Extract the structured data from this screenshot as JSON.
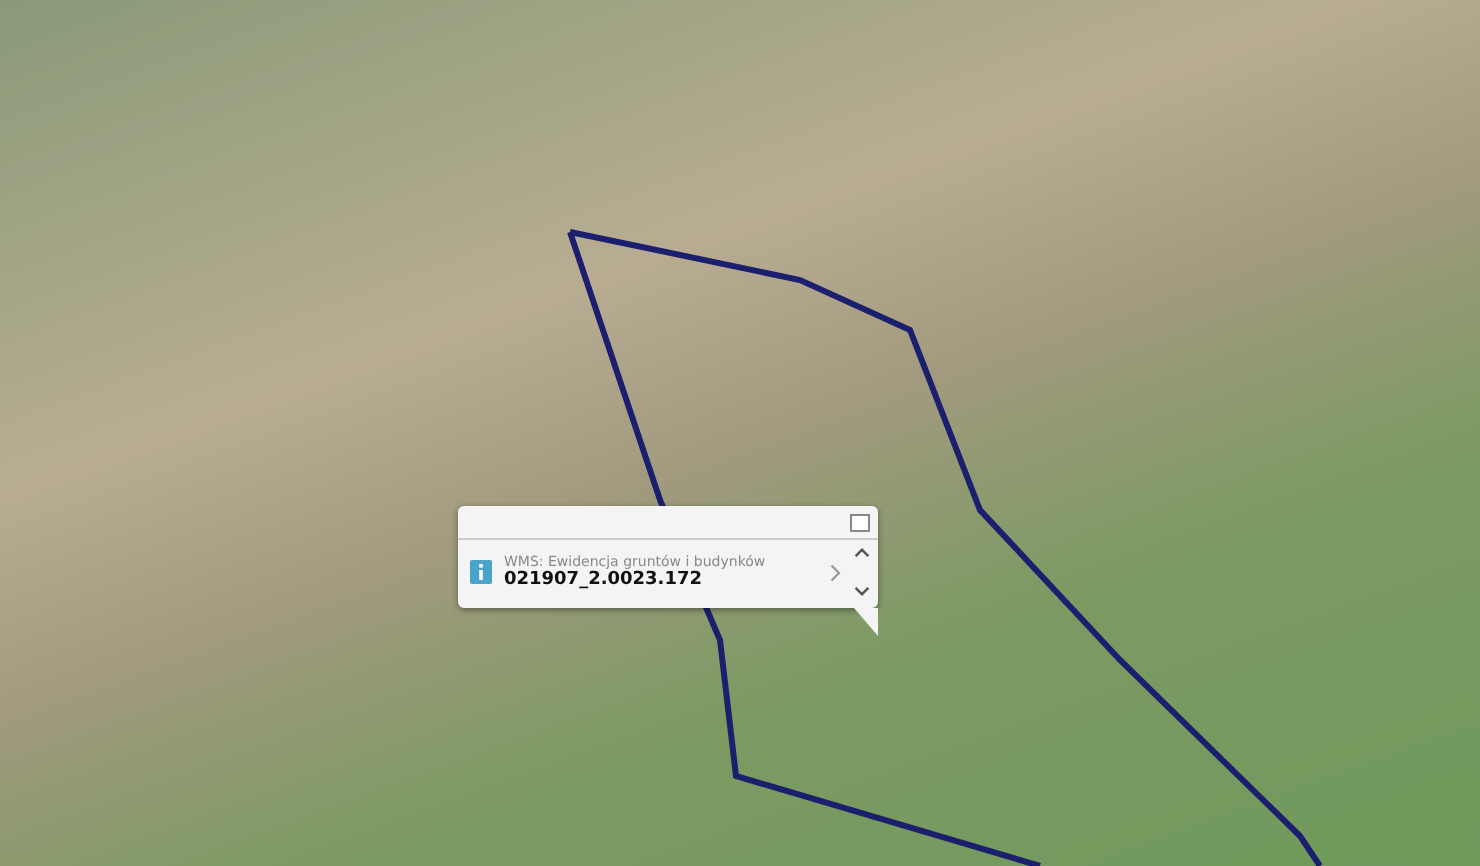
{
  "popup": {
    "source": "WMS: Ewidencja gruntów i budynków",
    "parcel_id": "021907_2.0023.172"
  }
}
